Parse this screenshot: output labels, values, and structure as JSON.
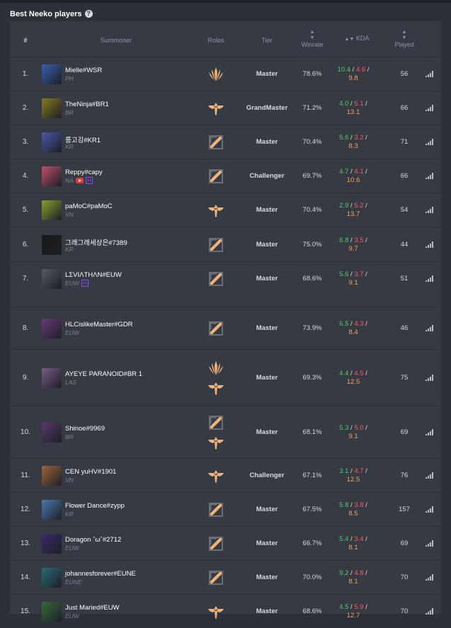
{
  "page": {
    "title": "Best Neeko players",
    "help_glyph": "?"
  },
  "columns": {
    "rank": "#",
    "summoner": "Summoner",
    "roles": "Roles",
    "tier": "Tier",
    "winrate": "Winrate",
    "kda": "KDA",
    "played": "Played"
  },
  "colors": {
    "background": "#2c3038",
    "panel": "#353a43",
    "kills": "#4ecb71",
    "deaths": "#ff5a5a",
    "assists": "#f5a25d",
    "role_icon": "#f0b27a"
  },
  "players": [
    {
      "rank": "1.",
      "name": "Mielle#WSR",
      "region": "PH",
      "roles": [
        "mid-icon"
      ],
      "tier": "Master",
      "winrate": "78.6%",
      "k": "10.4",
      "d": "4.6",
      "a": "9.8",
      "played": "56",
      "avatar": "#3a5fb0",
      "badges": []
    },
    {
      "rank": "2.",
      "name": "TheNinja#BR1",
      "region": "BR",
      "roles": [
        "support-icon"
      ],
      "tier": "GrandMaster",
      "winrate": "71.2%",
      "k": "4.0",
      "d": "5.1",
      "a": "13.1",
      "played": "66",
      "avatar": "#8a7a1e",
      "badges": []
    },
    {
      "rank": "3.",
      "name": "릉고깅#KR1",
      "region": "KR",
      "roles": [
        "top-icon"
      ],
      "tier": "Master",
      "winrate": "70.4%",
      "k": "5.6",
      "d": "3.2",
      "a": "8.3",
      "played": "71",
      "avatar": "#4a58a8",
      "badges": []
    },
    {
      "rank": "4.",
      "name": "Reppy#capy",
      "region": "NA",
      "roles": [
        "top-icon"
      ],
      "tier": "Challenger",
      "winrate": "69.7%",
      "k": "4.7",
      "d": "4.1",
      "a": "10.6",
      "played": "66",
      "avatar": "#c0506a",
      "badges": [
        "youtube-icon",
        "twitch-icon"
      ]
    },
    {
      "rank": "5.",
      "name": "paMoC#paMoC",
      "region": "VN",
      "roles": [
        "support-icon"
      ],
      "tier": "Master",
      "winrate": "70.4%",
      "k": "2.9",
      "d": "5.2",
      "a": "13.7",
      "played": "54",
      "avatar": "#8aa02a",
      "badges": []
    },
    {
      "rank": "6.",
      "name": "그래그래세상은#7389",
      "region": "KR",
      "roles": [
        "top-icon"
      ],
      "tier": "Master",
      "winrate": "75.0%",
      "k": "6.8",
      "d": "3.5",
      "a": "9.7",
      "played": "44",
      "avatar": "#1a1a1a",
      "badges": []
    },
    {
      "rank": "7.",
      "name": "LΣVIΛTHΛN#EUW",
      "region": "EUW",
      "roles": [
        "top-icon"
      ],
      "tier": "Master",
      "winrate": "68.6%",
      "k": "5.6",
      "d": "3.7",
      "a": "9.1",
      "played": "51",
      "avatar": "#555a60",
      "badges": [
        "twitch-icon"
      ]
    },
    {
      "rank": "8.",
      "name": "HLCislikeMaster#GDR",
      "region": "EUW",
      "roles": [
        "top-icon"
      ],
      "tier": "Master",
      "winrate": "73.9%",
      "k": "6.5",
      "d": "4.3",
      "a": "8.4",
      "played": "46",
      "avatar": "#6a3a7a",
      "badges": []
    },
    {
      "rank": "9.",
      "name": "AYEYE PARANOID#BR 1",
      "region": "LAS",
      "roles": [
        "mid-icon",
        "support-icon"
      ],
      "tier": "Master",
      "winrate": "69.3%",
      "k": "4.4",
      "d": "4.5",
      "a": "12.5",
      "played": "75",
      "avatar": "#7a5a8a",
      "badges": []
    },
    {
      "rank": "10.",
      "name": "Shinoe#9969",
      "region": "BR",
      "roles": [
        "top-icon",
        "support-icon"
      ],
      "tier": "Master",
      "winrate": "68.1%",
      "k": "5.3",
      "d": "5.0",
      "a": "9.1",
      "played": "69",
      "avatar": "#5a3a6a",
      "badges": []
    },
    {
      "rank": "11.",
      "name": "CEN yuHV#1901",
      "region": "VN",
      "roles": [
        "support-icon"
      ],
      "tier": "Challenger",
      "winrate": "67.1%",
      "k": "3.1",
      "d": "4.7",
      "a": "12.5",
      "played": "76",
      "avatar": "#a0643a",
      "badges": []
    },
    {
      "rank": "12.",
      "name": "Flower Dance#zypp",
      "region": "KR",
      "roles": [
        "top-icon"
      ],
      "tier": "Master",
      "winrate": "67.5%",
      "k": "5.8",
      "d": "3.8",
      "a": "8.5",
      "played": "157",
      "avatar": "#4a7ab0",
      "badges": []
    },
    {
      "rank": "13.",
      "name": "Doragon ˆωˆ#2712",
      "region": "EUW",
      "roles": [
        "top-icon"
      ],
      "tier": "Master",
      "winrate": "66.7%",
      "k": "5.4",
      "d": "3.4",
      "a": "8.1",
      "played": "69",
      "avatar": "#3a2a6a",
      "badges": []
    },
    {
      "rank": "14.",
      "name": "johannesforever#EUNE",
      "region": "EUNE",
      "roles": [
        "top-icon"
      ],
      "tier": "Master",
      "winrate": "70.0%",
      "k": "9.2",
      "d": "4.8",
      "a": "8.1",
      "played": "70",
      "avatar": "#2a6a7a",
      "badges": []
    },
    {
      "rank": "15.",
      "name": "Just Maried#EUW",
      "region": "EUW",
      "roles": [
        "support-icon"
      ],
      "tier": "Master",
      "winrate": "68.6%",
      "k": "4.5",
      "d": "5.9",
      "a": "12.7",
      "played": "70",
      "avatar": "#3a6a3a",
      "badges": []
    }
  ]
}
